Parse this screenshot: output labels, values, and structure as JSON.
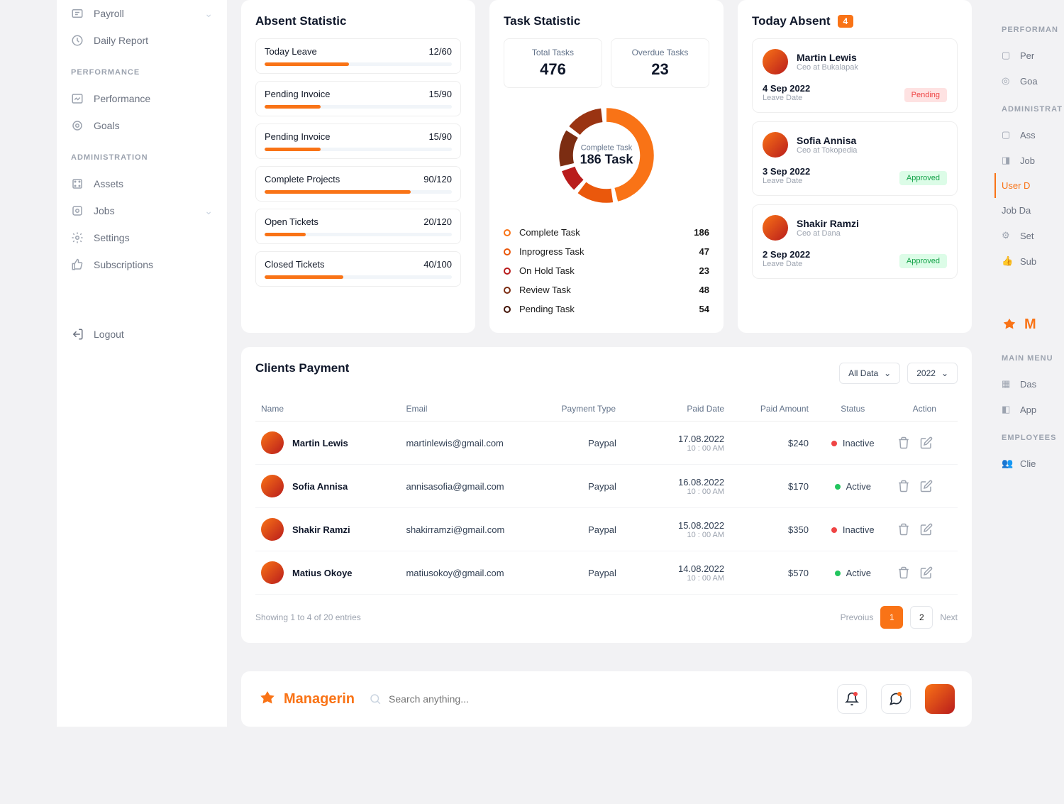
{
  "sidebar": {
    "items": [
      {
        "label": "Payroll",
        "icon": "payroll",
        "expand": true
      },
      {
        "label": "Daily Report",
        "icon": "report"
      }
    ],
    "performance_title": "PERFORMANCE",
    "performance": [
      {
        "label": "Performance",
        "icon": "chart"
      },
      {
        "label": "Goals",
        "icon": "target"
      }
    ],
    "admin_title": "ADMINISTRATION",
    "admin": [
      {
        "label": "Assets",
        "icon": "assets"
      },
      {
        "label": "Jobs",
        "icon": "jobs",
        "expand": true
      },
      {
        "label": "Settings",
        "icon": "settings"
      },
      {
        "label": "Subscriptions",
        "icon": "thumbs"
      }
    ],
    "logout": "Logout"
  },
  "absent_statistic": {
    "title": "Absent Statistic",
    "items": [
      {
        "label": "Today Leave",
        "value": "12/60",
        "fill": 45
      },
      {
        "label": "Pending Invoice",
        "value": "15/90",
        "fill": 30
      },
      {
        "label": "Pending Invoice",
        "value": "15/90",
        "fill": 30
      },
      {
        "label": "Complete Projects",
        "value": "90/120",
        "fill": 78
      },
      {
        "label": "Open Tickets",
        "value": "20/120",
        "fill": 22
      },
      {
        "label": "Closed Tickets",
        "value": "40/100",
        "fill": 42
      }
    ]
  },
  "task_statistic": {
    "title": "Task Statistic",
    "total_label": "Total Tasks",
    "total_value": "476",
    "overdue_label": "Overdue Tasks",
    "overdue_value": "23",
    "donut_label": "Complete Task",
    "donut_value": "186 Task",
    "tasks": [
      {
        "label": "Complete Task",
        "value": "186",
        "color": "#f97316"
      },
      {
        "label": "Inprogress Task",
        "value": "47",
        "color": "#ea580c"
      },
      {
        "label": "On Hold Task",
        "value": "23",
        "color": "#b91c1c"
      },
      {
        "label": "Review Task",
        "value": "48",
        "color": "#7c2d12"
      },
      {
        "label": "Pending Task",
        "value": "54",
        "color": "#431407"
      }
    ]
  },
  "today_absent": {
    "title": "Today Absent",
    "count": "4",
    "items": [
      {
        "name": "Martin Lewis",
        "role": "Ceo at Bukalapak",
        "date": "4 Sep 2022",
        "date_lbl": "Leave Date",
        "status": "Pending",
        "status_class": "pill-pending"
      },
      {
        "name": "Sofia Annisa",
        "role": "Ceo at Tokopedia",
        "date": "3 Sep 2022",
        "date_lbl": "Leave Date",
        "status": "Approved",
        "status_class": "pill-approved"
      },
      {
        "name": "Shakir Ramzi",
        "role": "Ceo at Dana",
        "date": "2 Sep 2022",
        "date_lbl": "Leave Date",
        "status": "Approved",
        "status_class": "pill-approved"
      }
    ]
  },
  "clients_payment": {
    "title": "Clients Payment",
    "filter1": "All Data",
    "filter2": "2022",
    "headers": [
      "Name",
      "Email",
      "Payment Type",
      "Paid Date",
      "Paid Amount",
      "Status",
      "Action"
    ],
    "rows": [
      {
        "name": "Martin Lewis",
        "email": "martinlewis@gmail.com",
        "type": "Paypal",
        "date": "17.08.2022",
        "time": "10 : 00 AM",
        "amount": "$240",
        "status": "Inactive",
        "status_class": "status-inactive"
      },
      {
        "name": "Sofia Annisa",
        "email": "annisasofia@gmail.com",
        "type": "Paypal",
        "date": "16.08.2022",
        "time": "10 : 00 AM",
        "amount": "$170",
        "status": "Active",
        "status_class": "status-active"
      },
      {
        "name": "Shakir Ramzi",
        "email": "shakirramzi@gmail.com",
        "type": "Paypal",
        "date": "15.08.2022",
        "time": "10 : 00 AM",
        "amount": "$350",
        "status": "Inactive",
        "status_class": "status-inactive"
      },
      {
        "name": "Matius Okoye",
        "email": "matiusokoy@gmail.com",
        "type": "Paypal",
        "date": "14.08.2022",
        "time": "10 : 00 AM",
        "amount": "$570",
        "status": "Active",
        "status_class": "status-active"
      }
    ],
    "showing": "Showing 1 to 4 of 20 entries",
    "prev": "Prevoius",
    "next": "Next",
    "pages": [
      "1",
      "2"
    ]
  },
  "bottom": {
    "brand": "Managerin",
    "search_placeholder": "Search anything..."
  },
  "rside": {
    "performance_title": "PERFORMAN",
    "performance": [
      "Per",
      "Goa"
    ],
    "admin_title": "ADMINISTRAT",
    "admin": [
      "Ass",
      "Job",
      "User D",
      "Job Da",
      "Set",
      "Sub"
    ],
    "brand": "M",
    "main_title": "MAIN MENU",
    "main": [
      "Das",
      "App"
    ],
    "emp_title": "EMPLOYEES",
    "emp": [
      "Clie"
    ]
  },
  "chart_data": {
    "type": "pie",
    "title": "Task Statistic",
    "series": [
      {
        "name": "Complete Task",
        "value": 186
      },
      {
        "name": "Inprogress Task",
        "value": 47
      },
      {
        "name": "On Hold Task",
        "value": 23
      },
      {
        "name": "Review Task",
        "value": 48
      },
      {
        "name": "Pending Task",
        "value": 54
      }
    ],
    "center_label": "Complete Task",
    "center_value": "186 Task"
  }
}
